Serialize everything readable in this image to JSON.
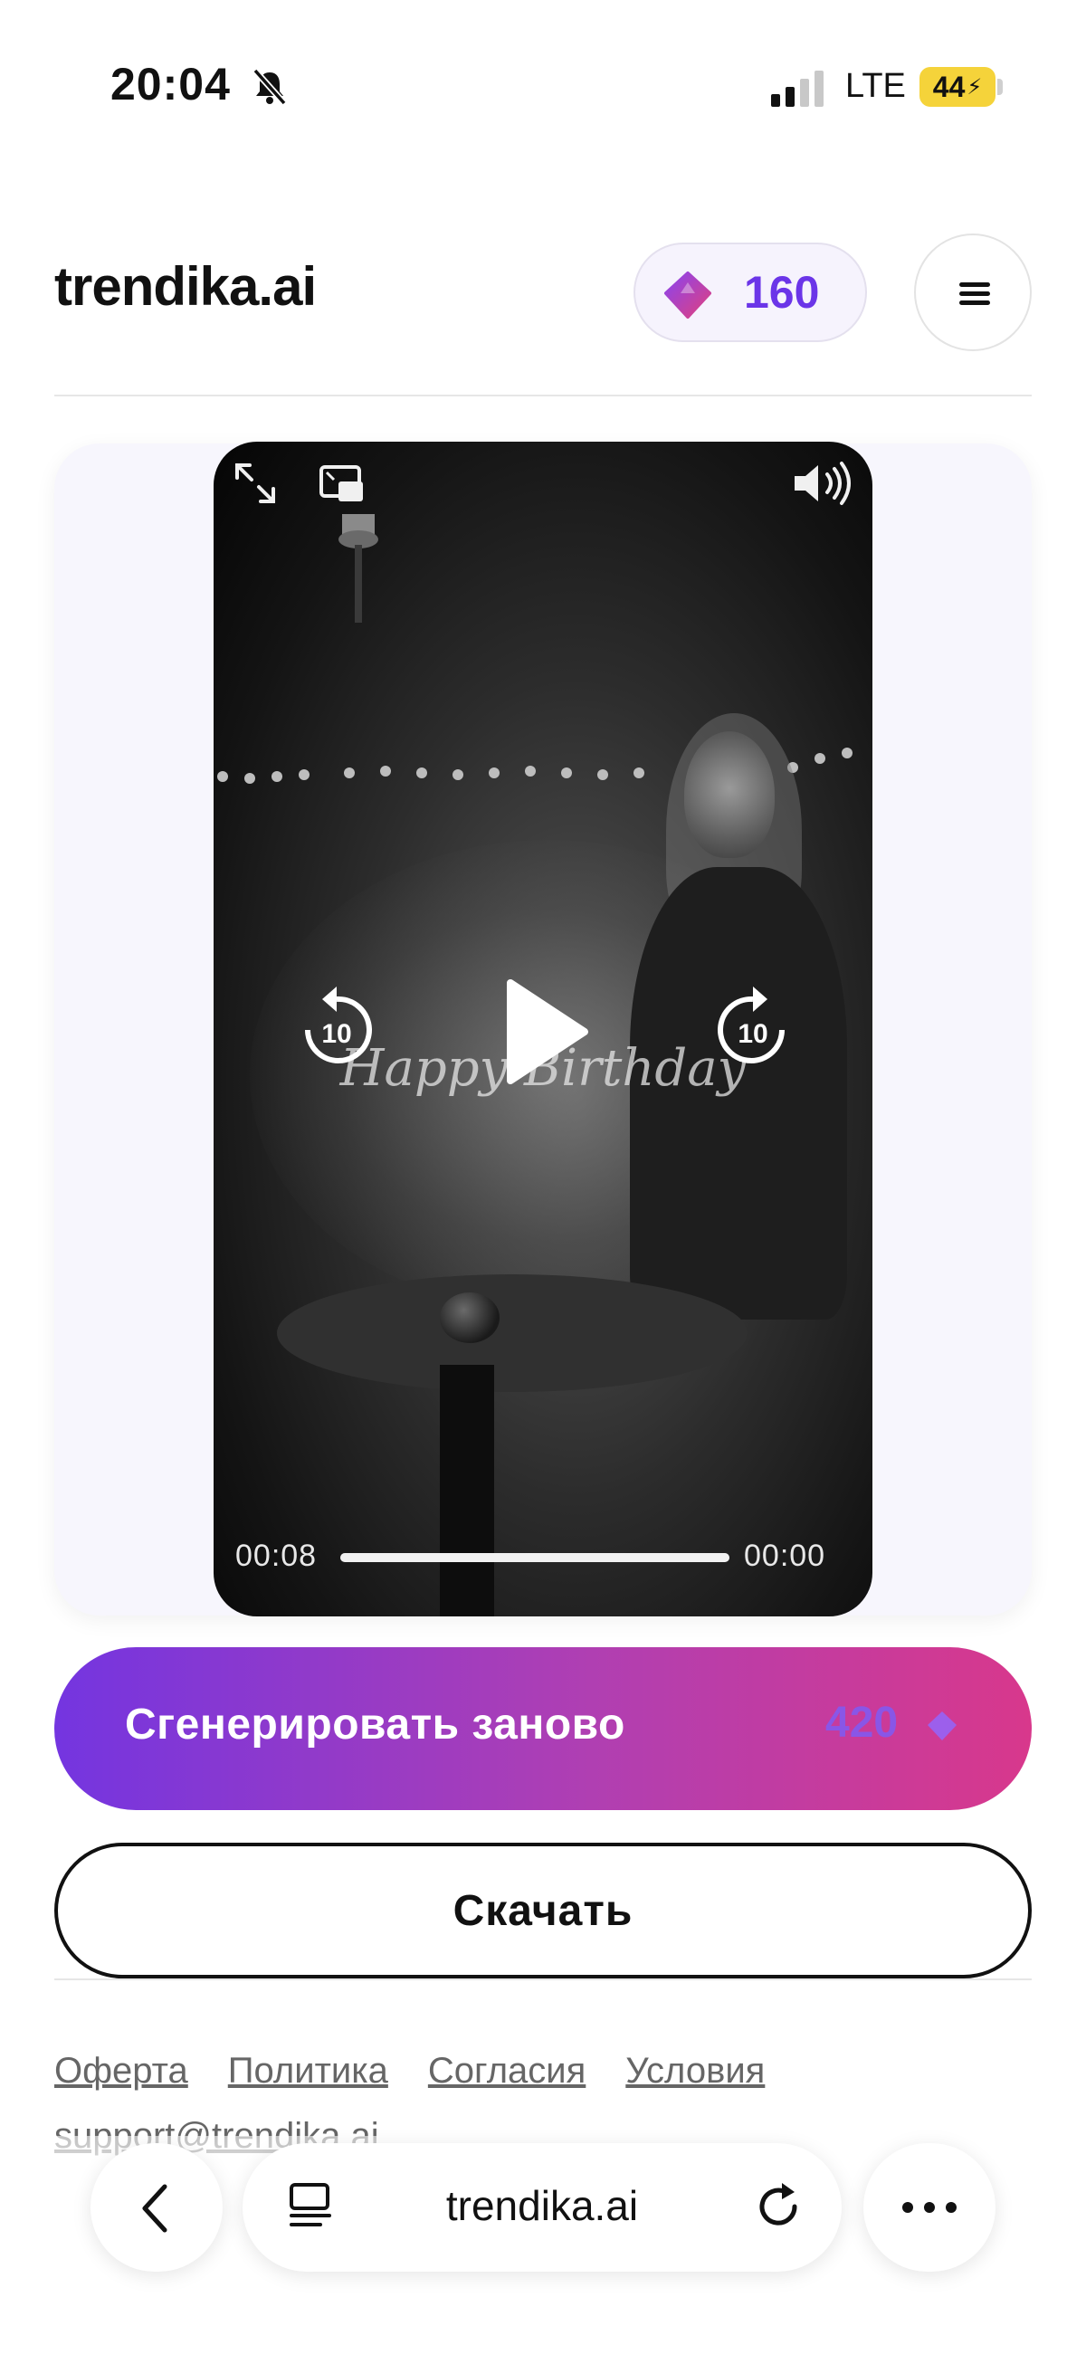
{
  "status_bar": {
    "time": "20:04",
    "network": "LTE",
    "battery": "44"
  },
  "header": {
    "logo": "trendika.ai",
    "credits": "160",
    "menu_icon": "hamburger-icon"
  },
  "video": {
    "overlay_text": "Happy Birthday",
    "current_time": "00:08",
    "remaining_time": "00:00",
    "progress": 1.0,
    "skip_back_label": "10",
    "skip_forward_label": "10"
  },
  "actions": {
    "regenerate_label": "Сгенерировать заново",
    "regenerate_cost": "420",
    "download_label": "Скачать"
  },
  "footer": {
    "links": [
      "Оферта",
      "Политика",
      "Согласия",
      "Условия"
    ],
    "support_email": "support@trendika.ai"
  },
  "browser": {
    "url": "trendika.ai"
  },
  "colors": {
    "accent": "#6b35e8",
    "gradient_start": "#7435e0",
    "gradient_end": "#d8388c"
  }
}
